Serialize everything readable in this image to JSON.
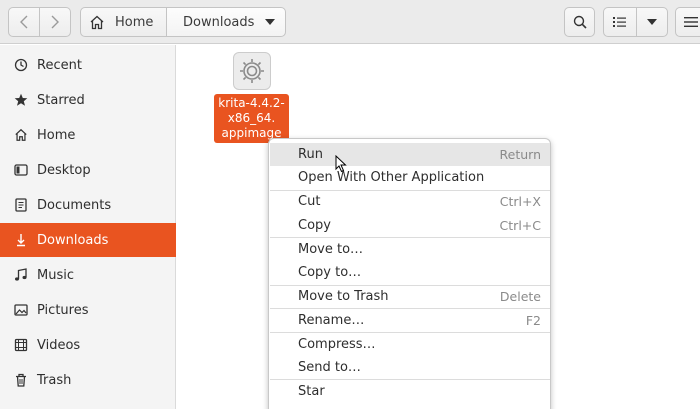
{
  "header": {
    "back_icon": "chevron-left",
    "forward_icon": "chevron-right",
    "path": [
      {
        "label": "Home",
        "icon": "home-icon"
      },
      {
        "label": "Downloads"
      }
    ],
    "search_icon": "search-icon",
    "view_icon": "list-view-icon",
    "view_options_icon": "chevron-down-icon"
  },
  "sidebar": {
    "items": [
      {
        "label": "Recent",
        "icon": "clock-icon"
      },
      {
        "label": "Starred",
        "icon": "star-icon"
      },
      {
        "label": "Home",
        "icon": "home-icon"
      },
      {
        "label": "Desktop",
        "icon": "desktop-icon"
      },
      {
        "label": "Documents",
        "icon": "document-icon"
      },
      {
        "label": "Downloads",
        "icon": "download-icon",
        "active": true
      },
      {
        "label": "Music",
        "icon": "music-icon"
      },
      {
        "label": "Pictures",
        "icon": "picture-icon"
      },
      {
        "label": "Videos",
        "icon": "video-icon"
      },
      {
        "label": "Trash",
        "icon": "trash-icon"
      }
    ]
  },
  "file": {
    "name_lines": [
      "krita-4.4.2-",
      "x86_64.",
      "appimage"
    ],
    "icon": "executable-gear-icon"
  },
  "context_menu": {
    "items": [
      {
        "label": "Run",
        "accel": "Return",
        "highlighted": true
      },
      {
        "label": "Open With Other Application",
        "accel": ""
      },
      {
        "label": "Cut",
        "accel": "Ctrl+X"
      },
      {
        "label": "Copy",
        "accel": "Ctrl+C"
      },
      {
        "label": "Move to…",
        "accel": ""
      },
      {
        "label": "Copy to…",
        "accel": ""
      },
      {
        "label": "Move to Trash",
        "accel": "Delete"
      },
      {
        "label": "Rename…",
        "accel": "F2"
      },
      {
        "label": "Compress…",
        "accel": ""
      },
      {
        "label": "Send to…",
        "accel": ""
      },
      {
        "label": "Star",
        "accel": ""
      }
    ]
  },
  "colors": {
    "accent": "#e95420",
    "sidebar_bg": "#f4f4f4",
    "header_bg": "#ebebeb"
  }
}
